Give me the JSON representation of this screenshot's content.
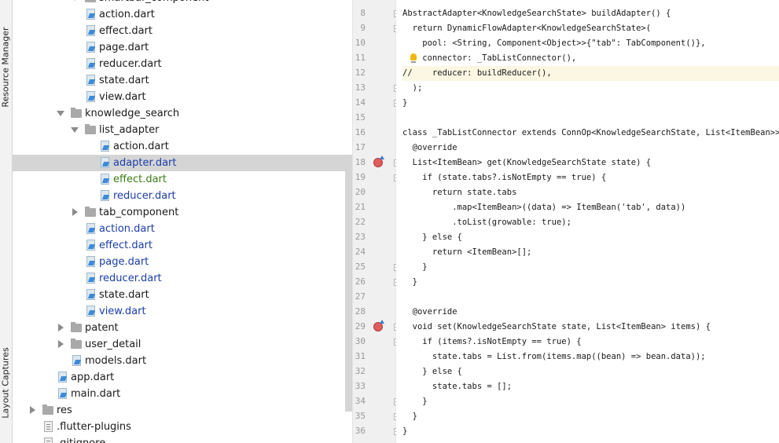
{
  "side_tabs": {
    "resource_manager": "Resource Manager",
    "layout_captures": "Layout Captures"
  },
  "tree_rows": [
    {
      "label": "smartbar_component",
      "kind": "folder"
    },
    {
      "label": "action.dart",
      "kind": "dart"
    },
    {
      "label": "effect.dart",
      "kind": "dart"
    },
    {
      "label": "page.dart",
      "kind": "dart"
    },
    {
      "label": "reducer.dart",
      "kind": "dart"
    },
    {
      "label": "state.dart",
      "kind": "dart"
    },
    {
      "label": "view.dart",
      "kind": "dart"
    },
    {
      "label": "knowledge_search",
      "kind": "folder",
      "expanded": true
    },
    {
      "label": "list_adapter",
      "kind": "folder",
      "expanded": true
    },
    {
      "label": "action.dart",
      "kind": "dart"
    },
    {
      "label": "adapter.dart",
      "kind": "dart",
      "selected": true,
      "color": "blue"
    },
    {
      "label": "effect.dart",
      "kind": "dart",
      "color": "green"
    },
    {
      "label": "reducer.dart",
      "kind": "dart",
      "color": "blue"
    },
    {
      "label": "tab_component",
      "kind": "folder",
      "expanded": false
    },
    {
      "label": "action.dart",
      "kind": "dart",
      "color": "blue"
    },
    {
      "label": "effect.dart",
      "kind": "dart",
      "color": "blue"
    },
    {
      "label": "page.dart",
      "kind": "dart",
      "color": "blue"
    },
    {
      "label": "reducer.dart",
      "kind": "dart",
      "color": "blue"
    },
    {
      "label": "state.dart",
      "kind": "dart"
    },
    {
      "label": "view.dart",
      "kind": "dart",
      "color": "blue"
    },
    {
      "label": "patent",
      "kind": "folder",
      "expanded": false
    },
    {
      "label": "user_detail",
      "kind": "folder",
      "expanded": false
    },
    {
      "label": "models.dart",
      "kind": "dart"
    },
    {
      "label": "app.dart",
      "kind": "dart"
    },
    {
      "label": "main.dart",
      "kind": "dart"
    },
    {
      "label": "res",
      "kind": "folder",
      "expanded": false
    },
    {
      "label": ".flutter-plugins",
      "kind": "plain"
    },
    {
      "label": ".gitignore",
      "kind": "plain"
    }
  ],
  "editor": {
    "lines": [
      {
        "n": "8",
        "code": "AbstractAdapter<KnowledgeSearchState> buildAdapter() {"
      },
      {
        "n": "9",
        "code": "  return DynamicFlowAdapter<KnowledgeSearchState>("
      },
      {
        "n": "10",
        "code": "    pool: <String, Component<Object>>{\"tab\": TabComponent()},"
      },
      {
        "n": "11",
        "code": "    connector: _TabListConnector(),"
      },
      {
        "n": "12",
        "code": "//    reducer: buildReducer(),"
      },
      {
        "n": "13",
        "code": "  );"
      },
      {
        "n": "14",
        "code": "}"
      },
      {
        "n": "15",
        "code": ""
      },
      {
        "n": "16",
        "code": "class _TabListConnector extends ConnOp<KnowledgeSearchState, List<ItemBean>> {"
      },
      {
        "n": "17",
        "code": "  @override"
      },
      {
        "n": "18",
        "code": "  List<ItemBean> get(KnowledgeSearchState state) {"
      },
      {
        "n": "19",
        "code": "    if (state.tabs?.isNotEmpty == true) {"
      },
      {
        "n": "20",
        "code": "      return state.tabs"
      },
      {
        "n": "21",
        "code": "          .map<ItemBean>((data) => ItemBean('tab', data))"
      },
      {
        "n": "22",
        "code": "          .toList(growable: true);"
      },
      {
        "n": "23",
        "code": "    } else {"
      },
      {
        "n": "24",
        "code": "      return <ItemBean>[];"
      },
      {
        "n": "25",
        "code": "    }"
      },
      {
        "n": "26",
        "code": "  }"
      },
      {
        "n": "27",
        "code": ""
      },
      {
        "n": "28",
        "code": "  @override"
      },
      {
        "n": "29",
        "code": "  void set(KnowledgeSearchState state, List<ItemBean> items) {"
      },
      {
        "n": "30",
        "code": "    if (items?.isNotEmpty == true) {"
      },
      {
        "n": "31",
        "code": "      state.tabs = List.from(items.map((bean) => bean.data));"
      },
      {
        "n": "32",
        "code": "    } else {"
      },
      {
        "n": "33",
        "code": "      state.tabs = [];"
      },
      {
        "n": "34",
        "code": "    }"
      },
      {
        "n": "35",
        "code": "  }"
      },
      {
        "n": "36",
        "code": "}"
      }
    ]
  },
  "colors": {
    "selection": "#d5d5d5",
    "keyword": "#000080",
    "string": "#008000",
    "field": "#660e7a",
    "comment": "#808080",
    "annotation": "#808000",
    "vcs_modified": "#1a3ea8",
    "vcs_added": "#3a7d14",
    "highlight_line": "#fbf7e3"
  }
}
